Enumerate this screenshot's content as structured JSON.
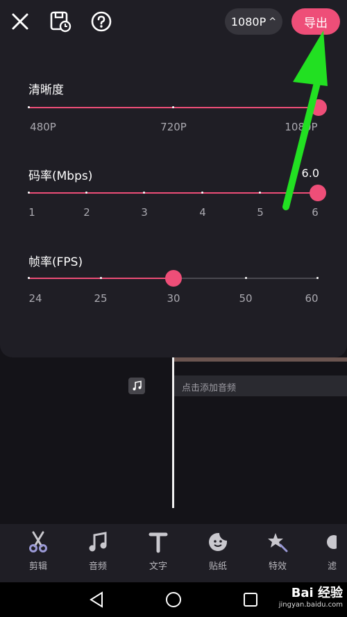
{
  "header": {
    "resolution_label": "1080P",
    "resolution_caret": "^",
    "export_label": "导出"
  },
  "clarity": {
    "title": "清晰度",
    "ticks": [
      "480P",
      "720P",
      "1080P"
    ],
    "level": 1.0
  },
  "bitrate": {
    "title": "码率(Mbps)",
    "value": "6.0",
    "ticks": [
      "1",
      "2",
      "3",
      "4",
      "5",
      "6"
    ],
    "level": 1.0
  },
  "framerate": {
    "title": "帧率(FPS)",
    "ticks": [
      "24",
      "25",
      "30",
      "50",
      "60"
    ],
    "level": 0.5
  },
  "timeline": {
    "audio_placeholder": "点击添加音频"
  },
  "toolbar": {
    "items": [
      {
        "label": "剪辑",
        "icon": "scissors-icon"
      },
      {
        "label": "音频",
        "icon": "music-note-icon"
      },
      {
        "label": "文字",
        "icon": "text-icon"
      },
      {
        "label": "贴纸",
        "icon": "sticker-icon"
      },
      {
        "label": "特效",
        "icon": "effects-star-icon"
      },
      {
        "label": "滤",
        "icon": "filter-icon"
      }
    ]
  },
  "watermark": {
    "brand": "Bai 经验",
    "url": "jingyan.baidu.com"
  },
  "colors": {
    "accent": "#ee4e78",
    "annotation_arrow": "#22e022"
  }
}
